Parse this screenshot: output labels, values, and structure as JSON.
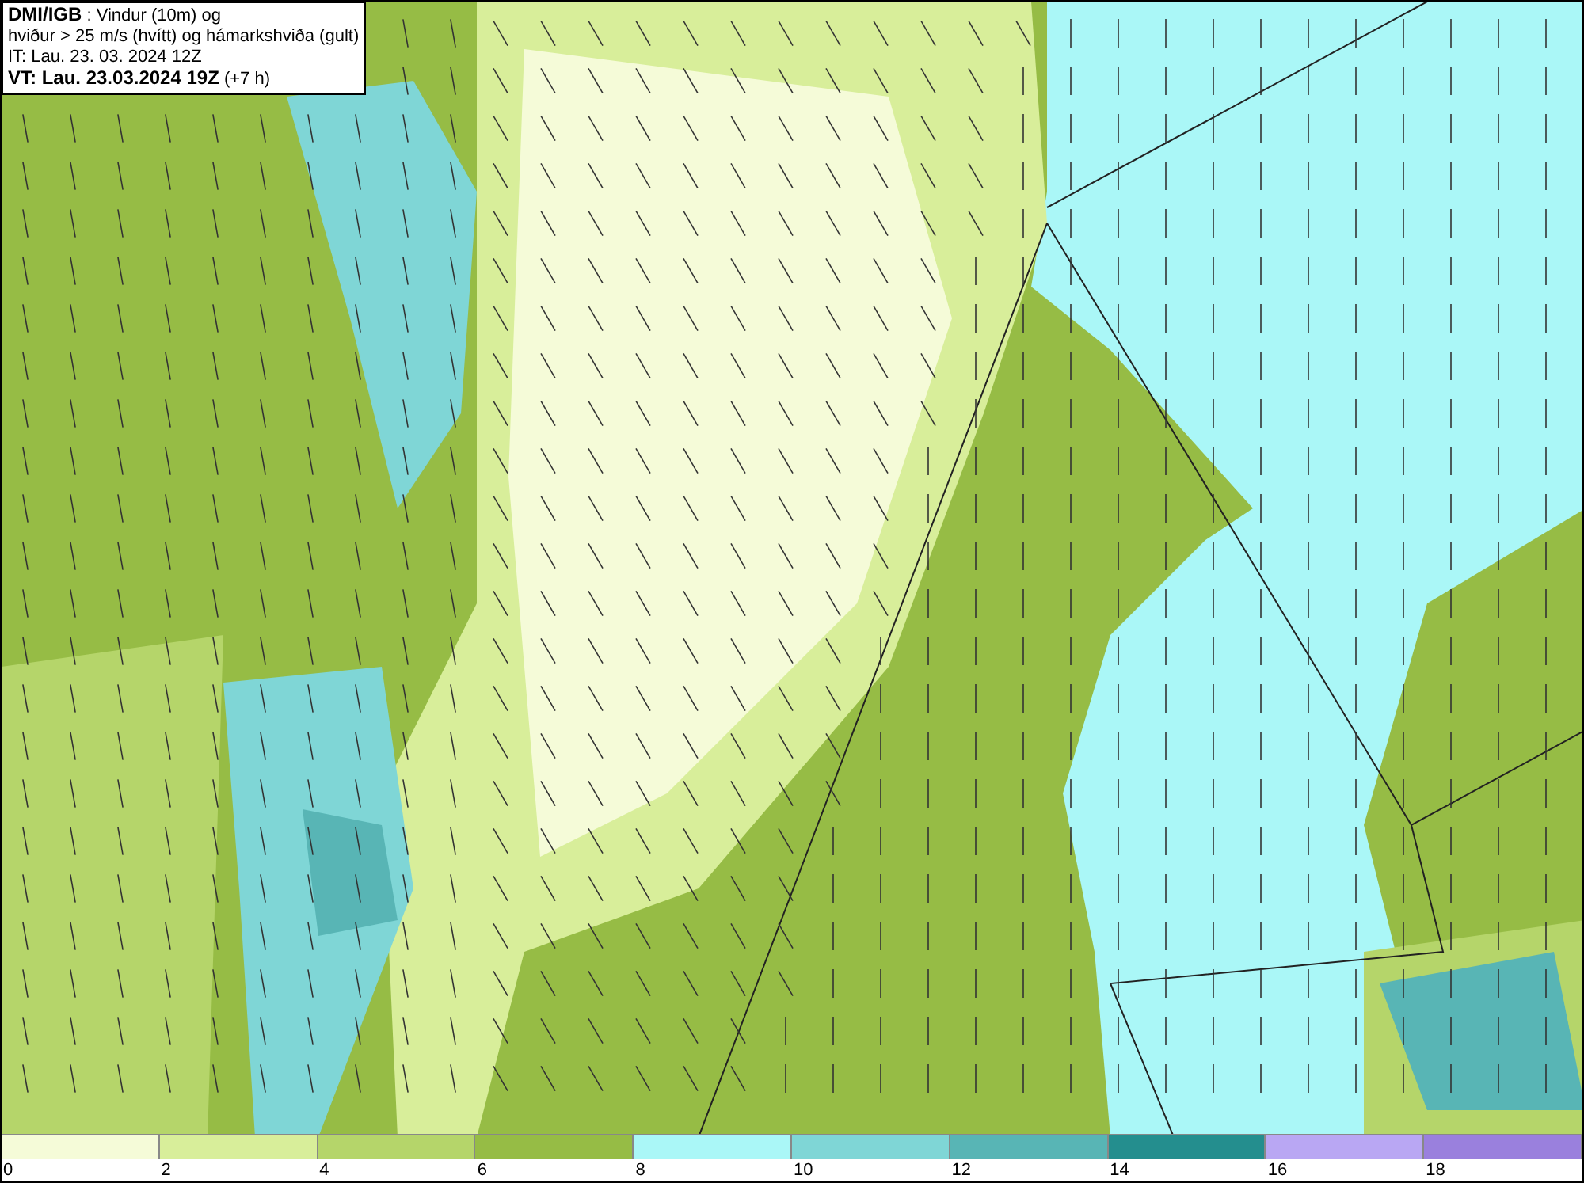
{
  "title_box": {
    "lines": [
      "**DMI/IGB** : Vindur (10m) og",
      "hviður > 25 m/s (hvítt) og hámarkshviða (gult)",
      "IT: Lau. 23. 03. 2024 12Z",
      "**VT: Lau. 23.03.2024 19Z** (+7 h)"
    ]
  },
  "legend": {
    "items": [
      {
        "label": "0",
        "color": "#f5fbd8"
      },
      {
        "label": "2",
        "color": "#d8ee9a"
      },
      {
        "label": "4",
        "color": "#b5d56a"
      },
      {
        "label": "6",
        "color": "#96bc45"
      },
      {
        "label": "8",
        "color": "#aaf7f7"
      },
      {
        "label": "10",
        "color": "#7fd6d6"
      },
      {
        "label": "12",
        "color": "#58b5b5"
      },
      {
        "label": "14",
        "color": "#248e8e"
      },
      {
        "label": "16",
        "color": "#b9a7f3"
      },
      {
        "label": "18",
        "color": "#9a80dd"
      }
    ]
  }
}
